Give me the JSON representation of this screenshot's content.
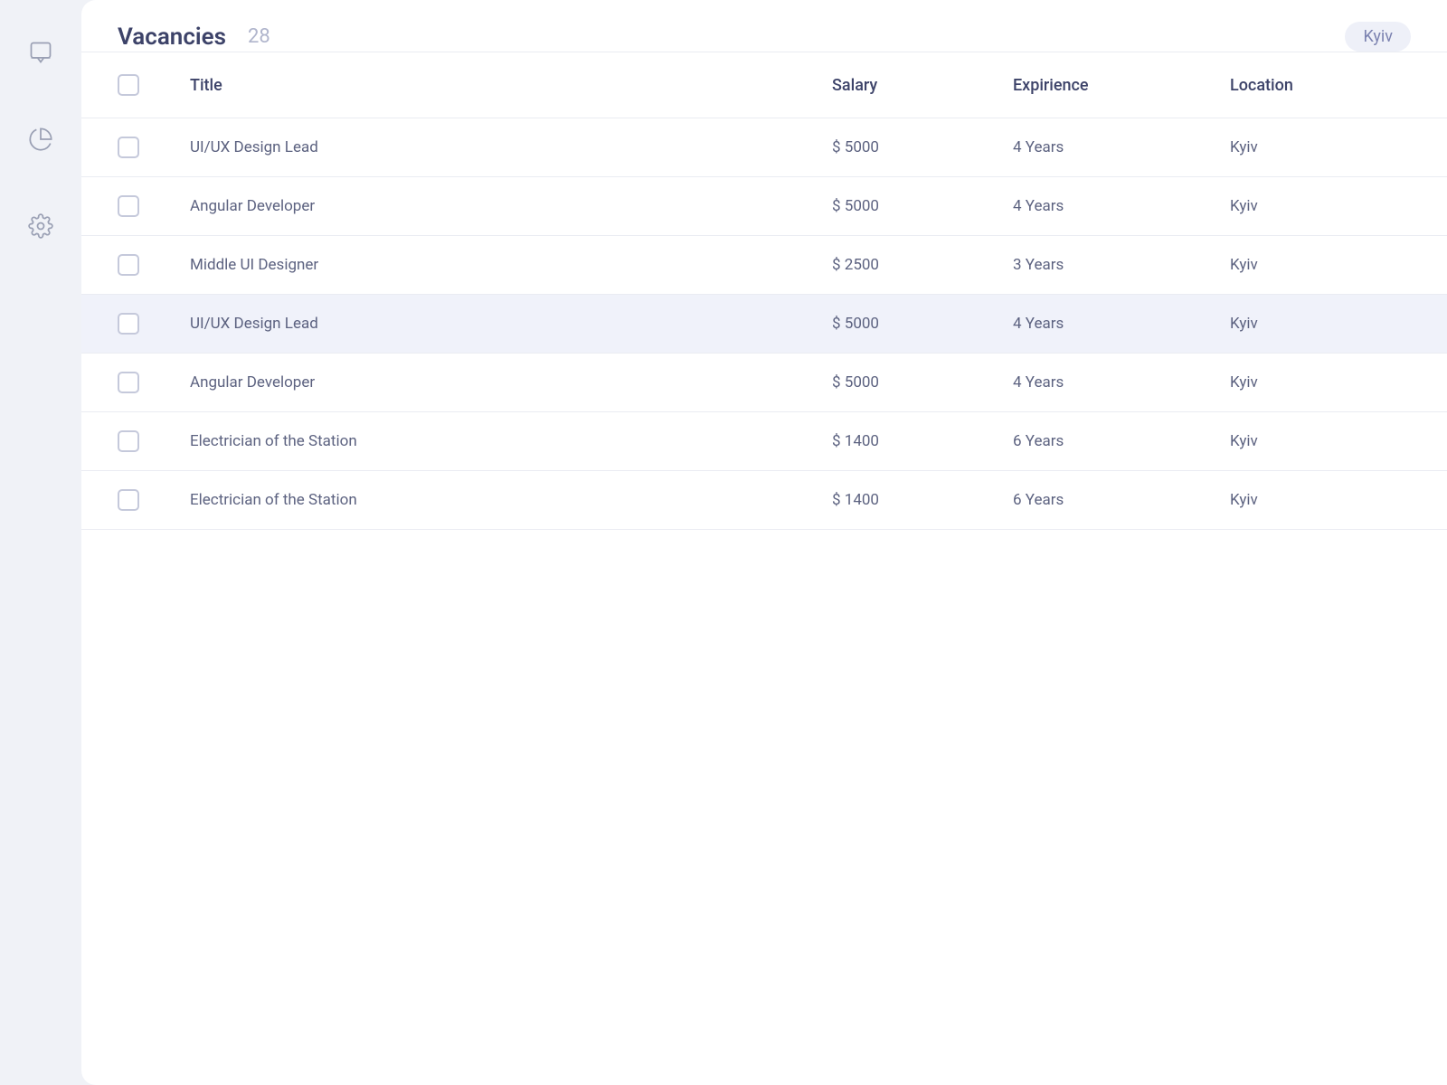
{
  "sidebar": {
    "icons": [
      {
        "name": "chat-icon",
        "type": "chat"
      },
      {
        "name": "chart-icon",
        "type": "chart"
      },
      {
        "name": "settings-icon",
        "type": "settings"
      }
    ]
  },
  "header": {
    "title": "Vacancies",
    "count": "28",
    "filter_label": "Kyiv"
  },
  "table": {
    "columns": [
      {
        "key": "checkbox",
        "label": ""
      },
      {
        "key": "title",
        "label": "Title"
      },
      {
        "key": "salary",
        "label": "Salary"
      },
      {
        "key": "experience",
        "label": "Expirience"
      },
      {
        "key": "location",
        "label": "Location"
      }
    ],
    "rows": [
      {
        "id": 1,
        "title": "UI/UX Design Lead",
        "salary": "$ 5000",
        "experience": "4 Years",
        "location": "Kyiv",
        "highlighted": false
      },
      {
        "id": 2,
        "title": "Angular Developer",
        "salary": "$ 5000",
        "experience": "4 Years",
        "location": "Kyiv",
        "highlighted": false
      },
      {
        "id": 3,
        "title": "Middle UI Designer",
        "salary": "$ 2500",
        "experience": "3 Years",
        "location": "Kyiv",
        "highlighted": false
      },
      {
        "id": 4,
        "title": "UI/UX Design Lead",
        "salary": "$ 5000",
        "experience": "4 Years",
        "location": "Kyiv",
        "highlighted": true
      },
      {
        "id": 5,
        "title": "Angular Developer",
        "salary": "$ 5000",
        "experience": "4 Years",
        "location": "Kyiv",
        "highlighted": false
      },
      {
        "id": 6,
        "title": "Electrician of the Station",
        "salary": "$ 1400",
        "experience": "6 Years",
        "location": "Kyiv",
        "highlighted": false
      },
      {
        "id": 7,
        "title": "Electrician of the Station",
        "salary": "$ 1400",
        "experience": "6 Years",
        "location": "Kyiv",
        "highlighted": false
      }
    ]
  }
}
